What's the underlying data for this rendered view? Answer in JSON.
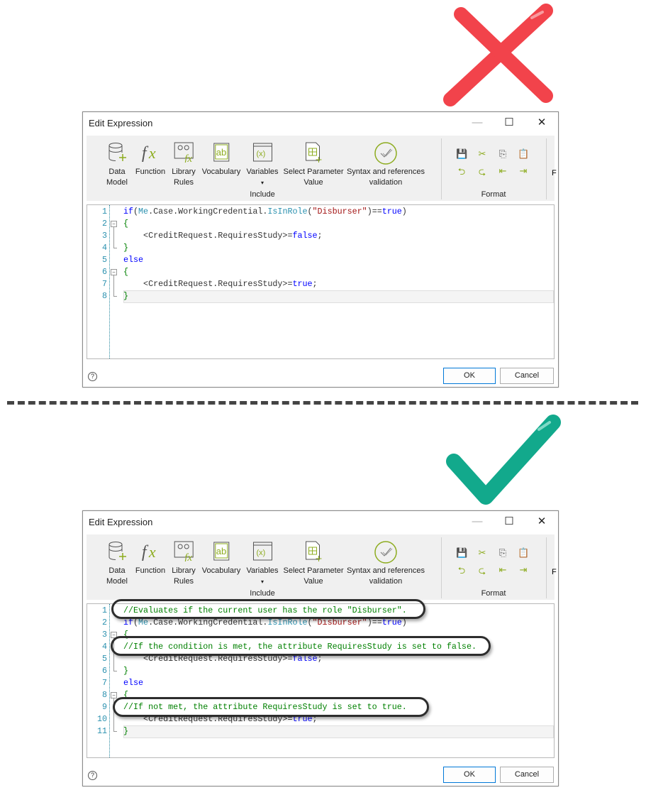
{
  "colors": {
    "wrong": "#f2434b",
    "right": "#12a98c",
    "keyword": "#0000ff",
    "comment": "#008000",
    "string": "#a31515",
    "member": "#2b91af",
    "accent": "#8dac1f"
  },
  "icons": {
    "wrong_mark": "x-mark-icon",
    "right_mark": "check-mark-icon"
  },
  "dialogs": [
    {
      "title": "Edit Expression",
      "ribbon": {
        "items": [
          {
            "label1": "Data",
            "label2": "Model",
            "icon": "database-add-icon"
          },
          {
            "label1": "Function",
            "label2": "",
            "icon": "fx-icon"
          },
          {
            "label1": "Library",
            "label2": "Rules",
            "icon": "library-rules-icon"
          },
          {
            "label1": "Vocabulary",
            "label2": "",
            "icon": "vocabulary-icon"
          },
          {
            "label1": "Variables",
            "label2": "▾",
            "icon": "variables-icon"
          },
          {
            "label1": "Select Parameter",
            "label2": "Value",
            "icon": "table-add-icon"
          },
          {
            "label1": "Syntax and references",
            "label2": "validation",
            "icon": "validation-check-icon"
          }
        ],
        "include_label": "Include",
        "format_label": "Format",
        "cut_label": "F"
      },
      "lines": [
        [
          [
            "if",
            "k"
          ],
          [
            "(",
            "d"
          ],
          [
            "Me",
            "m"
          ],
          [
            ".Case.WorkingCredential.",
            "d"
          ],
          [
            "IsInRole",
            "m"
          ],
          [
            "(",
            "d"
          ],
          [
            "\"Disburser\"",
            "s"
          ],
          [
            ")==",
            "d"
          ],
          [
            "true",
            "k"
          ],
          [
            ")",
            "d"
          ]
        ],
        [
          [
            "{",
            "c"
          ]
        ],
        [
          [
            "    <CreditRequest.RequiresStudy>=",
            "d"
          ],
          [
            "false",
            "k"
          ],
          [
            ";",
            "d"
          ]
        ],
        [
          [
            "}",
            "c"
          ]
        ],
        [
          [
            "else",
            "k"
          ]
        ],
        [
          [
            "{",
            "c"
          ]
        ],
        [
          [
            "    <CreditRequest.RequiresStudy>=",
            "d"
          ],
          [
            "true",
            "k"
          ],
          [
            ";",
            "d"
          ]
        ],
        [
          [
            "}",
            "c"
          ]
        ]
      ],
      "ok": "OK",
      "cancel": "Cancel",
      "help": "?"
    },
    {
      "title": "Edit Expression",
      "ribbon": {
        "items": [
          {
            "label1": "Data",
            "label2": "Model",
            "icon": "database-add-icon"
          },
          {
            "label1": "Function",
            "label2": "",
            "icon": "fx-icon"
          },
          {
            "label1": "Library",
            "label2": "Rules",
            "icon": "library-rules-icon"
          },
          {
            "label1": "Vocabulary",
            "label2": "",
            "icon": "vocabulary-icon"
          },
          {
            "label1": "Variables",
            "label2": "▾",
            "icon": "variables-icon"
          },
          {
            "label1": "Select Parameter",
            "label2": "Value",
            "icon": "table-add-icon"
          },
          {
            "label1": "Syntax and references",
            "label2": "validation",
            "icon": "validation-check-icon"
          }
        ],
        "include_label": "Include",
        "format_label": "Format",
        "cut_label": "F"
      },
      "lines": [
        [
          [
            "//Evaluates if the current user has the role \"Disburser\".",
            "c"
          ]
        ],
        [
          [
            "if",
            "k"
          ],
          [
            "(",
            "d"
          ],
          [
            "Me",
            "m"
          ],
          [
            ".Case.WorkingCredential.",
            "d"
          ],
          [
            "IsInRole",
            "m"
          ],
          [
            "(",
            "d"
          ],
          [
            "\"Disburser\"",
            "s"
          ],
          [
            ")==",
            "d"
          ],
          [
            "true",
            "k"
          ],
          [
            ")",
            "d"
          ]
        ],
        [
          [
            "{",
            "c"
          ]
        ],
        [
          [
            "//If the condition is met, the attribute RequiresStudy is set to false.",
            "c"
          ]
        ],
        [
          [
            "    <CreditRequest.RequiresStudy>=",
            "d"
          ],
          [
            "false",
            "k"
          ],
          [
            ";",
            "d"
          ]
        ],
        [
          [
            "}",
            "c"
          ]
        ],
        [
          [
            "else",
            "k"
          ]
        ],
        [
          [
            "{",
            "c"
          ]
        ],
        [
          [
            "//If not met, the attribute RequiresStudy is set to true.",
            "c"
          ]
        ],
        [
          [
            "    <CreditRequest.RequiresStudy>=",
            "d"
          ],
          [
            "true",
            "k"
          ],
          [
            ";",
            "d"
          ]
        ],
        [
          [
            "}",
            "c"
          ]
        ]
      ],
      "ok": "OK",
      "cancel": "Cancel",
      "help": "?"
    }
  ]
}
